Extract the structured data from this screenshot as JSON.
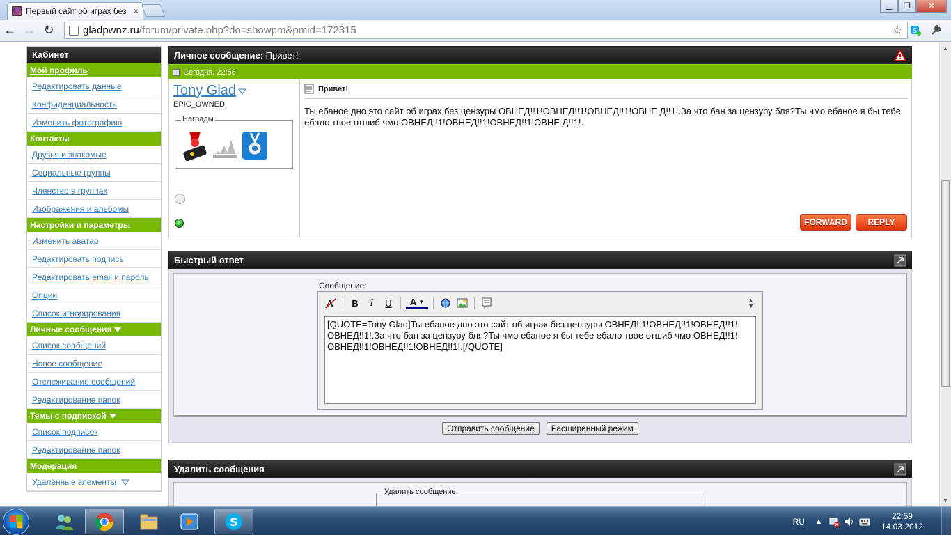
{
  "browser": {
    "tab_title": "Первый сайт об играх без",
    "tab_close": "×",
    "url_domain": "gladpwnz.ru",
    "url_path": "/forum/private.php?do=showpm&pmid=172315"
  },
  "sidebar": {
    "header": "Кабинет",
    "sections": [
      {
        "title": "Мой профиль",
        "link": true,
        "items": [
          "Редактировать данные",
          "Конфиденциальность",
          "Изменить фотографию"
        ]
      },
      {
        "title": "Контакты",
        "items": [
          "Друзья и знакомые",
          "Социальные группы",
          "Членство в группах",
          "Изображения и альбомы"
        ]
      },
      {
        "title": "Настройки и параметры",
        "items": [
          "Изменить аватар",
          "Редактировать подпись",
          "Редактировать email и пароль",
          "Опции",
          "Список игнорирования"
        ]
      },
      {
        "title": "Личные сообщения",
        "arrow": true,
        "items": [
          "Список сообщений",
          "Новое сообщение",
          "Отслеживание сообщений",
          "Редактирование папок"
        ]
      },
      {
        "title": "Темы с подпиской",
        "arrow": true,
        "items": [
          "Список подписок",
          "Редактирование папок"
        ]
      },
      {
        "title": "Модерация",
        "items": [
          "Удалённые элементы"
        ]
      }
    ]
  },
  "message": {
    "header_label": "Личное сообщение:",
    "header_subject": "Привет!",
    "date": "Сегодня, 22:56",
    "username": "Tony Glad",
    "usertitle": "EPIC_OWNED!!",
    "awards_label": "Награды",
    "title": "Привет!",
    "text": "Ты ебаное дно это сайт об играх без цензуры ОВНЕД!!1!ОВНЕД!!1!ОВНЕД!!1!ОВНЕ Д!!1!.За что бан за цензуру бля?Ты чмо ебаное я бы тебе ебало твое отшиб чмо ОВНЕД!!1!ОВНЕД!!1!ОВНЕД!!1!ОВНЕ Д!!1!.",
    "forward_label": "FORWARD",
    "reply_label": "REPLY"
  },
  "quick_reply": {
    "header": "Быстрый ответ",
    "message_label": "Сообщение:",
    "editor_text": "[QUOTE=Tony Glad]Ты ебаное дно это сайт об играх без цензуры ОВНЕД!!1!ОВНЕД!!1!ОВНЕД!!1!ОВНЕД!!1!.За что бан за цензуру бля?Ты чмо ебаное я бы тебе ебало твое отшиб чмо ОВНЕД!!1!ОВНЕД!!1!ОВНЕД!!1!ОВНЕД!!1!.[/QUOTE]",
    "tools": {
      "bold": "B",
      "italic": "I",
      "underline": "U",
      "color": "A"
    },
    "submit_label": "Отправить сообщение",
    "advanced_label": "Расширенный режим"
  },
  "delete": {
    "header": "Удалить сообщения",
    "legend": "Удалить сообщение"
  },
  "taskbar": {
    "lang": "RU",
    "time": "22:59",
    "date": "14.03.2012"
  },
  "colors": {
    "accent_green": "#76b900",
    "link_blue": "#3a7cb3",
    "header_dark": "#1a1a1a",
    "button_red": "#e0360a"
  }
}
